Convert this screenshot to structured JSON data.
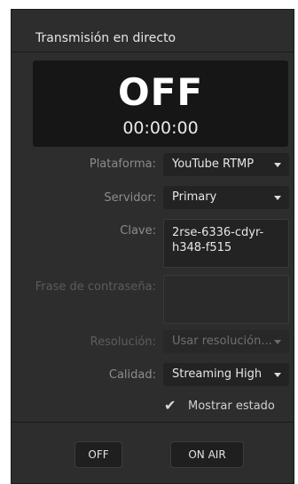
{
  "panel": {
    "title": "Transmisión en directo"
  },
  "status": {
    "state": "OFF",
    "timer": "00:00:00"
  },
  "fields": {
    "platform": {
      "label": "Plataforma:",
      "value": "YouTube RTMP"
    },
    "server": {
      "label": "Servidor:",
      "value": "Primary"
    },
    "key": {
      "label": "Clave:",
      "value": "2rse-6336-cdyr-\nh348-f515"
    },
    "passphrase": {
      "label": "Frase de contraseña:",
      "value": ""
    },
    "resolution": {
      "label": "Resolución:",
      "value": "Usar resolución..."
    },
    "quality": {
      "label": "Calidad:",
      "value": "Streaming High"
    }
  },
  "show_status": {
    "label": "Mostrar estado",
    "checked": true,
    "icon": "✔"
  },
  "buttons": {
    "off": "OFF",
    "on_air": "ON AIR"
  }
}
